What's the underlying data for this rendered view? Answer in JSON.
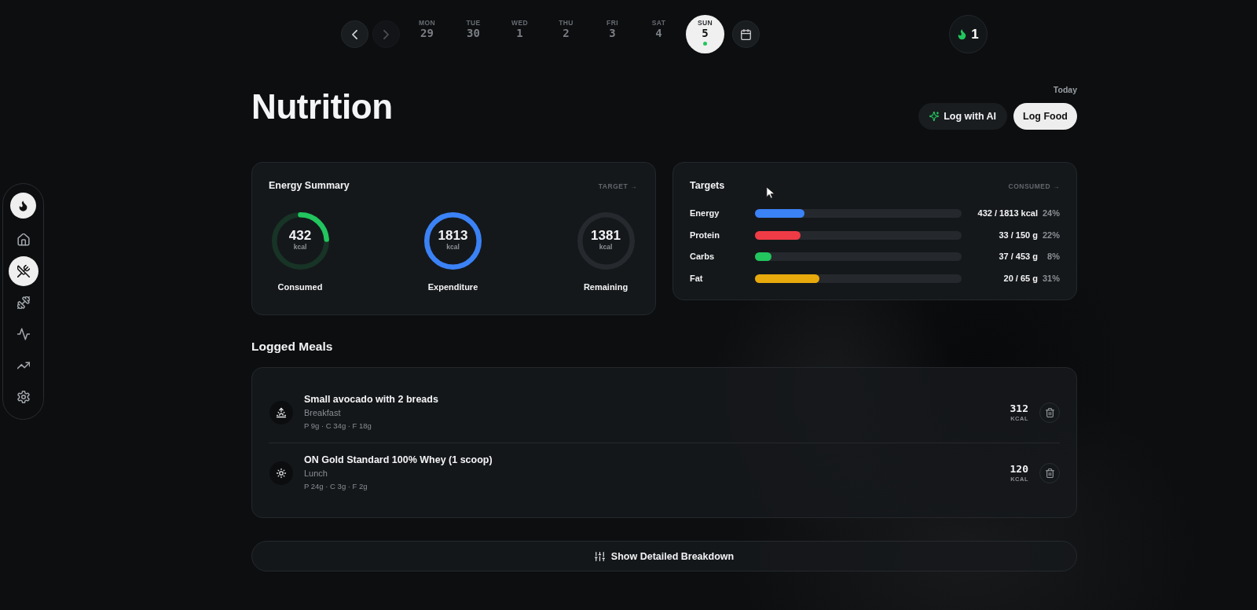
{
  "sidebar": {
    "items": [
      {
        "selected": false
      },
      {
        "selected": true
      },
      {
        "selected": false
      },
      {
        "selected": false
      },
      {
        "selected": false
      },
      {
        "selected": false
      }
    ]
  },
  "date_nav": {
    "prev": {
      "disabled": false
    },
    "next": {
      "disabled": true
    },
    "days": [
      {
        "weekday": "MON",
        "day": "29",
        "selected": false
      },
      {
        "weekday": "TUE",
        "day": "30",
        "selected": false
      },
      {
        "weekday": "WED",
        "day": "1",
        "selected": false
      },
      {
        "weekday": "THU",
        "day": "2",
        "selected": false
      },
      {
        "weekday": "FRI",
        "day": "3",
        "selected": false
      },
      {
        "weekday": "SAT",
        "day": "4",
        "selected": false
      },
      {
        "weekday": "SUN",
        "day": "5",
        "selected": true
      }
    ]
  },
  "streak": {
    "count": "1"
  },
  "header": {
    "title": "Nutrition",
    "date_label": "Today",
    "actions": [
      {
        "kind": "ai",
        "label": "Log with AI"
      },
      {
        "kind": "primary",
        "label": "Log Food"
      }
    ]
  },
  "energy_summary": {
    "title": "Energy Summary",
    "link": "TARGET →",
    "rings": [
      {
        "value": "432",
        "unit": "kcal",
        "label": "Consumed",
        "level": 0.24,
        "color": "#22c55e"
      },
      {
        "value": "1813",
        "unit": "kcal",
        "label": "Expenditure",
        "level": 1,
        "color": "#3b82f6"
      },
      {
        "value": "1381",
        "unit": "kcal",
        "label": "Remaining",
        "level": 1,
        "color": "#26292d"
      }
    ]
  },
  "targets": {
    "title": "Targets",
    "link": "CONSUMED →",
    "rows": [
      {
        "name": "Energy",
        "level": 0.24,
        "color": "#3b82f6",
        "amount": "432 / 1813 kcal",
        "percent": "24%"
      },
      {
        "name": "Protein",
        "level": 0.22,
        "color": "#ef3b45",
        "amount": "33 / 150 g",
        "percent": "22%"
      },
      {
        "name": "Carbs",
        "level": 0.08,
        "color": "#22c55e",
        "amount": "37 / 453 g",
        "percent": "8%"
      },
      {
        "name": "Fat",
        "level": 0.31,
        "color": "#e8a90c",
        "amount": "20 / 65 g",
        "percent": "31%"
      }
    ]
  },
  "logged_meals": {
    "title": "Logged Meals",
    "meals": [
      {
        "kind": "breakfast",
        "name": "Small avocado with 2 breads",
        "meal": "Breakfast",
        "macros": "P 9g · C 34g · F 18g",
        "kcal": "312",
        "unit": "KCAL"
      },
      {
        "kind": "lunch",
        "name": "ON Gold Standard 100% Whey (1 scoop)",
        "meal": "Lunch",
        "macros": "P 24g · C 3g · F 2g",
        "kcal": "120",
        "unit": "KCAL"
      }
    ]
  },
  "breakdown_button": {
    "label": "Show Detailed Breakdown"
  }
}
